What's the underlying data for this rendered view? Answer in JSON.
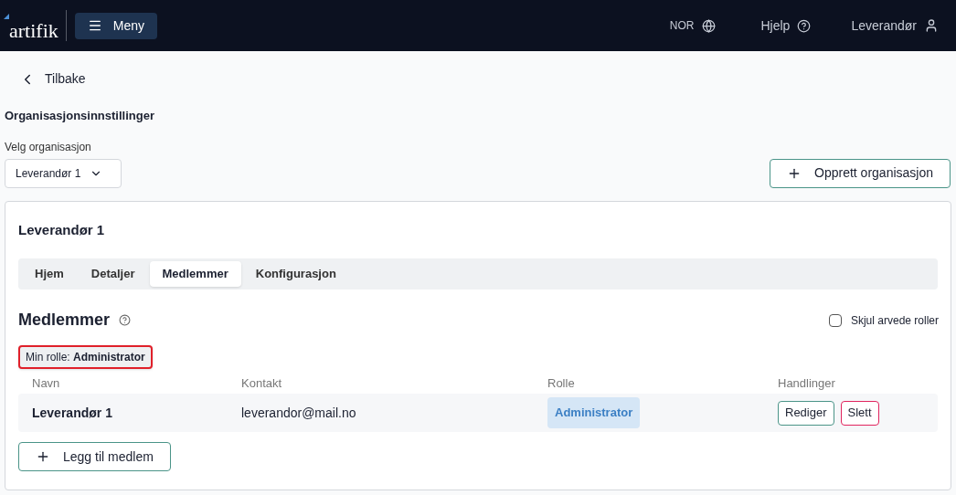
{
  "header": {
    "logo": "artifik",
    "menu_button": "Meny",
    "language": "NOR",
    "help": "Hjelp",
    "user": "Leverandør"
  },
  "back_link": "Tilbake",
  "page_title": "Organisasjonsinnstillinger",
  "org_select": {
    "label": "Velg organisasjon",
    "value": "Leverandør 1"
  },
  "create_button": "Opprett organisasjon",
  "card": {
    "title": "Leverandør 1",
    "tabs": [
      {
        "label": "Hjem",
        "selected": false
      },
      {
        "label": "Detaljer",
        "selected": false
      },
      {
        "label": "Medlemmer",
        "selected": true
      },
      {
        "label": "Konfigurasjon",
        "selected": false
      }
    ],
    "section_title": "Medlemmer",
    "hide_inherited": {
      "label": "Skjul arvede roller",
      "checked": false
    },
    "my_role": {
      "text": "Min rolle: **Administrator**",
      "highlighted": true
    },
    "table": {
      "columns": [
        "Navn",
        "Kontakt",
        "Rolle",
        "Handlinger"
      ],
      "rows": [
        {
          "name": "Leverandør 1",
          "contact": "leverandor@mail.no",
          "role": "Administrator",
          "actions": [
            {
              "kind": "edit",
              "label": "Rediger"
            },
            {
              "kind": "delete",
              "label": "Slett"
            }
          ]
        }
      ]
    },
    "add_button": "Legg til medlem"
  }
}
